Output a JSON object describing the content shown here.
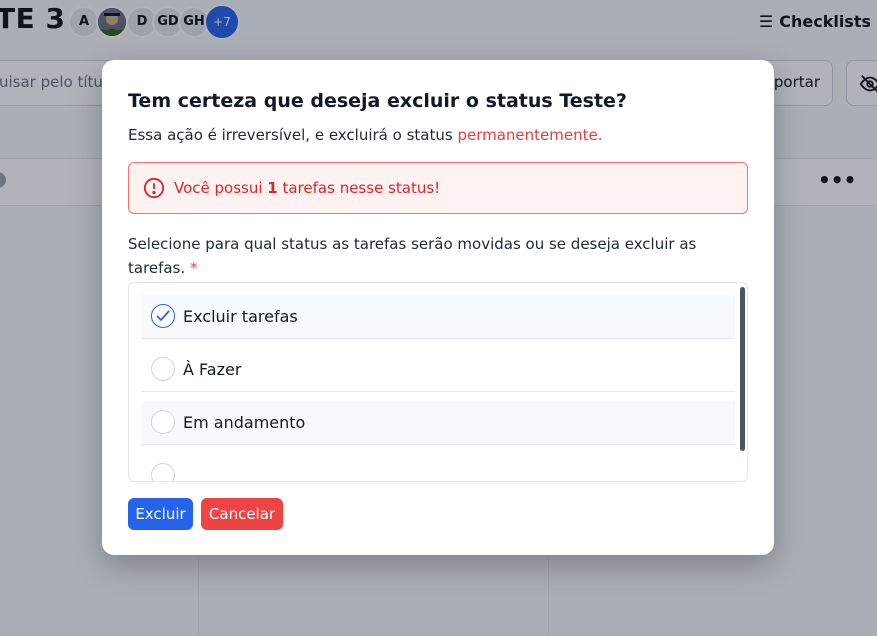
{
  "background": {
    "board_title": "TE 3",
    "avatars": [
      "A",
      "",
      "D",
      "GD",
      "GH"
    ],
    "avatars_more": "+7",
    "checklists_label": "Checklists",
    "search_placeholder": "uisar pelo títul",
    "export_label": "portar"
  },
  "modal": {
    "title": "Tem certeza que deseja excluir o status Teste?",
    "description": "Essa ação é irreversível, e excluirá o status ",
    "description_emphasis": "permanentemente.",
    "alert": {
      "prefix": "Você possui ",
      "count": "1",
      "suffix": " tarefas nesse status!"
    },
    "select_label": "Selecione para qual status as tarefas serão movidas ou se deseja excluir as tarefas.",
    "required_mark": "*",
    "options": [
      {
        "label": "Excluir tarefas",
        "checked": true
      },
      {
        "label": "À Fazer",
        "checked": false
      },
      {
        "label": "Em andamento",
        "checked": false
      }
    ],
    "confirm_label": "Excluir",
    "cancel_label": "Cancelar"
  },
  "colors": {
    "primary": "#2563eb",
    "danger": "#ef4444",
    "alert_bg": "#fef2f2",
    "alert_border": "#f87171"
  }
}
